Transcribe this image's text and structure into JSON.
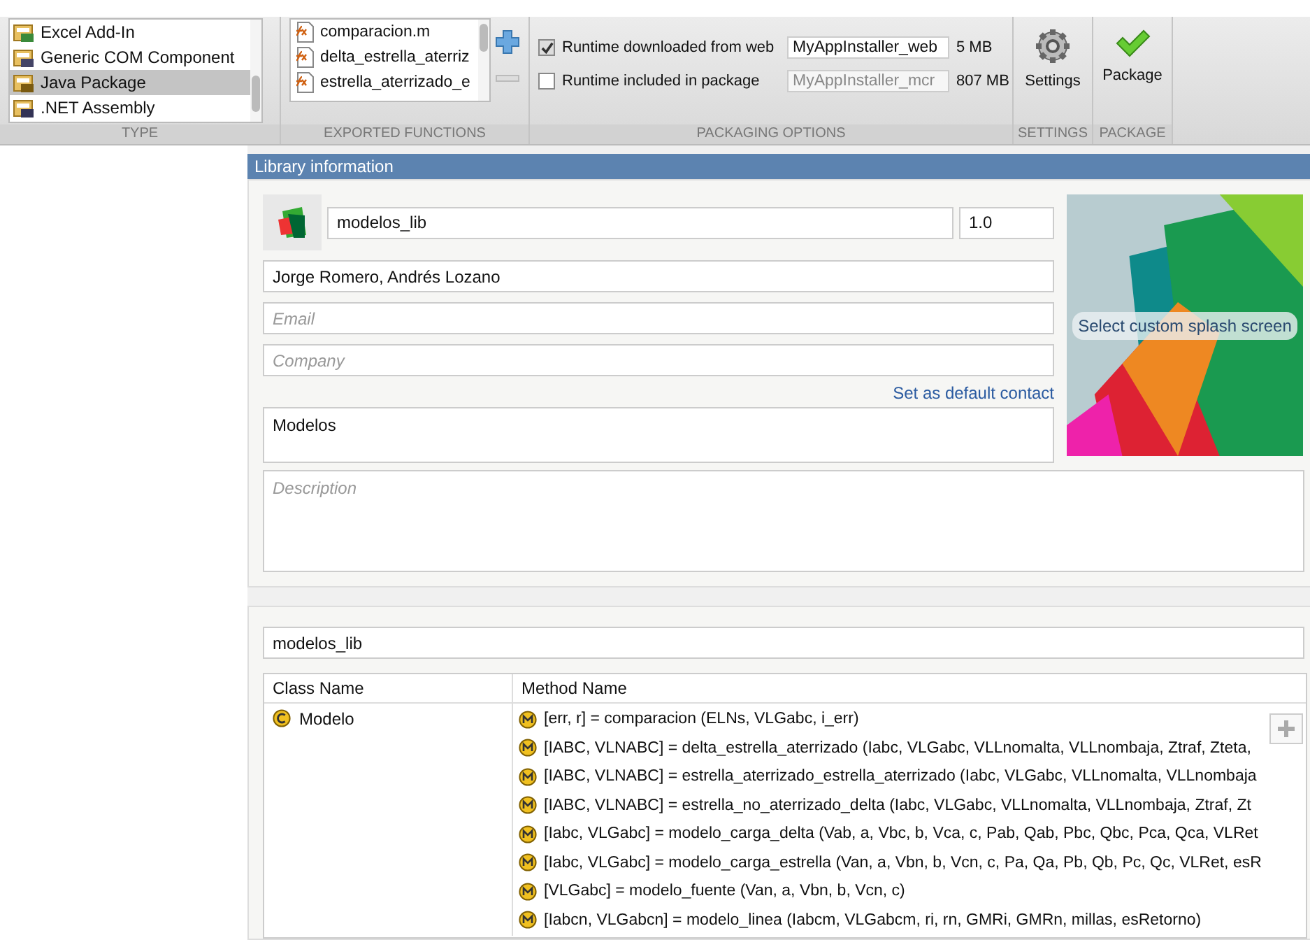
{
  "ribbon": {
    "type": {
      "label": "TYPE",
      "items": [
        {
          "kind": "excel",
          "label": "Excel Add-In",
          "selected": false
        },
        {
          "kind": "com",
          "label": "Generic COM Component",
          "selected": false
        },
        {
          "kind": "java",
          "label": "Java Package",
          "selected": true
        },
        {
          "kind": "net",
          "label": ".NET Assembly",
          "selected": false
        }
      ]
    },
    "exported_functions": {
      "label": "EXPORTED FUNCTIONS",
      "items": [
        "comparacion.m",
        "delta_estrella_aterriz",
        "estrella_aterrizado_e"
      ]
    },
    "packaging_options": {
      "label": "PACKAGING OPTIONS",
      "rows": [
        {
          "label": "Runtime downloaded from web",
          "checked": true,
          "value": "MyAppInstaller_web",
          "size": "5 MB"
        },
        {
          "label": "Runtime included in package",
          "checked": false,
          "value": "MyAppInstaller_mcr",
          "size": "807 MB"
        }
      ]
    },
    "settings": {
      "label": "SETTINGS",
      "button": "Settings"
    },
    "package": {
      "label": "PACKAGE",
      "button": "Package"
    }
  },
  "library_information": {
    "title": "Library information",
    "name": "modelos_lib",
    "version": "1.0",
    "author": "Jorge Romero, Andrés Lozano",
    "email_placeholder": "Email",
    "company_placeholder": "Company",
    "default_contact_link": "Set as default contact",
    "summary": "Modelos",
    "description_placeholder": "Description",
    "splash_button": "Select custom splash screen"
  },
  "classes": {
    "package_name": "modelos_lib",
    "columns": [
      "Class Name",
      "Method Name"
    ],
    "rows": [
      {
        "class": "Modelo",
        "methods": [
          "[err, r] = comparacion (ELNs, VLGabc, i_err)",
          "[IABC, VLNABC] = delta_estrella_aterrizado (Iabc, VLGabc, VLLnomalta, VLLnombaja, Ztraf, Zteta,",
          "[IABC, VLNABC] = estrella_aterrizado_estrella_aterrizado (Iabc, VLGabc, VLLnomalta, VLLnombaja",
          "[IABC, VLNABC] = estrella_no_aterrizado_delta (Iabc, VLGabc, VLLnomalta, VLLnombaja, Ztraf, Zt",
          "[Iabc, VLGabc] = modelo_carga_delta (Vab, a, Vbc, b, Vca, c, Pab, Qab, Pbc, Qbc, Pca, Qca, VLRet",
          "[Iabc, VLGabc] = modelo_carga_estrella (Van, a, Vbn, b, Vcn, c, Pa, Qa, Pb, Qb, Pc, Qc, VLRet, esR",
          "[VLGabc] = modelo_fuente (Van, a, Vbn, b, Vcn, c)",
          "[Iabcn, VLGabcn] = modelo_linea (Iabcm, VLGabcm, ri, rn, GMRi, GMRn, millas, esRetorno)"
        ]
      }
    ]
  }
}
